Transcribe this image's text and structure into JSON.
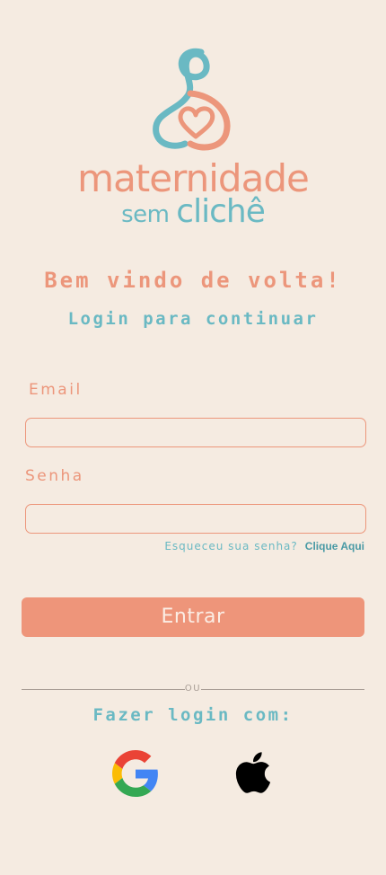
{
  "brand": {
    "name_line1": "maternidade",
    "name_line2a": "sem ",
    "name_line2b": "clichê",
    "colors": {
      "coral": "#ec967b",
      "teal": "#6ab9c3",
      "background": "#f5ebe1",
      "button": "#ee957a"
    }
  },
  "welcome": {
    "title": "Bem vindo de volta!",
    "subtitle": "Login para continuar"
  },
  "form": {
    "email_label": "Email",
    "email_value": "",
    "senha_label": "Senha",
    "senha_value": "",
    "forgot_text": "Esqueceu sua senha?",
    "forgot_link": "Clique Aqui",
    "submit_label": "Entrar"
  },
  "social": {
    "divider_text": "OU",
    "title": "Fazer login com:",
    "providers": [
      {
        "name": "Google",
        "icon": "google-icon"
      },
      {
        "name": "Apple",
        "icon": "apple-icon"
      }
    ]
  }
}
